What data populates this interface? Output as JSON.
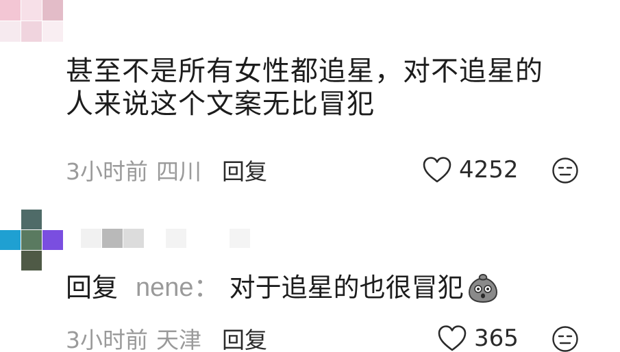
{
  "comment": {
    "text_line1": "甚至不是所有女性都追星，对不追星的",
    "text_line2": "人来说这个文案无比冒犯",
    "time": "3小时前",
    "location": "四川",
    "reply_label": "回复",
    "likes": "4252",
    "avatar_colors": [
      "#f3c6d4",
      "#f7e0e8",
      "#e3bcc8",
      "#f6eaef",
      "#f0d4de",
      "#f9eef2"
    ]
  },
  "reply": {
    "prefix": "回复",
    "author": "nene",
    "colon": "：",
    "text": "对于追星的也很冒犯",
    "time": "3小时前",
    "location": "天津",
    "reply_label": "回复",
    "likes": "365",
    "avatar_colors": [
      "#ffffff",
      "#4f6b68",
      "#ffffff",
      "#1fa0d2",
      "#5a7a60",
      "#7a4ee0",
      "#ffffff",
      "#4f5a46",
      "#ffffff"
    ],
    "name_colors": [
      "#f1f1f1",
      "#b9b9b9",
      "#dcdcdc",
      "#ffffff",
      "#f3f3f3",
      "#ffffff",
      "#ffffff",
      "#f4f4f4"
    ]
  }
}
